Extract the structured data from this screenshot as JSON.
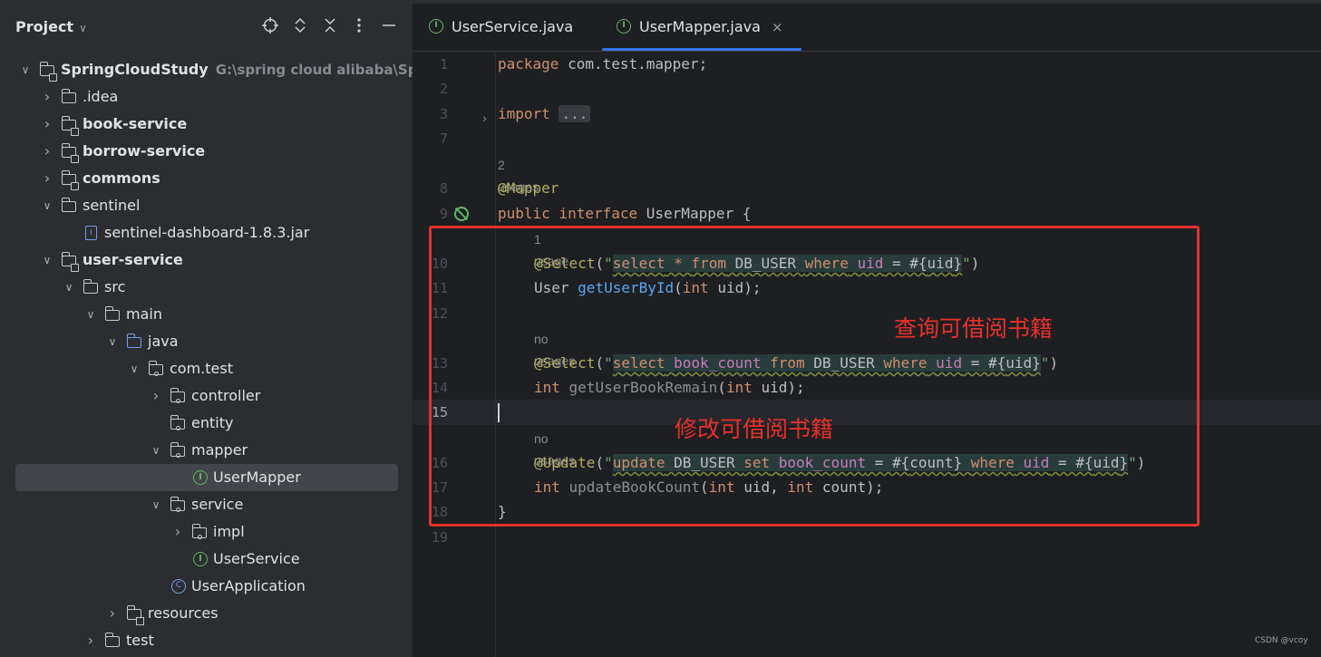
{
  "project_panel": {
    "title": "Project",
    "header_icons": [
      "locate-icon",
      "expand-all-icon",
      "collapse-all-icon",
      "more-icon",
      "minimize-icon"
    ],
    "tree": [
      {
        "label": "SpringCloudStudy",
        "hint": "G:\\spring cloud alibaba\\Sprin",
        "icon": "module-folder-icon",
        "depth": 0,
        "expanded": true,
        "bold": true
      },
      {
        "label": ".idea",
        "icon": "folder-icon",
        "depth": 1,
        "expanded": false,
        "bold": false
      },
      {
        "label": "book-service",
        "icon": "module-folder-icon",
        "depth": 1,
        "expanded": false,
        "bold": true
      },
      {
        "label": "borrow-service",
        "icon": "module-folder-icon",
        "depth": 1,
        "expanded": false,
        "bold": true
      },
      {
        "label": "commons",
        "icon": "module-folder-icon",
        "depth": 1,
        "expanded": false,
        "bold": true
      },
      {
        "label": "sentinel",
        "icon": "folder-icon",
        "depth": 1,
        "expanded": true,
        "bold": false
      },
      {
        "label": "sentinel-dashboard-1.8.3.jar",
        "icon": "jar-icon",
        "depth": 2,
        "expanded": null,
        "bold": false
      },
      {
        "label": "user-service",
        "icon": "module-folder-icon",
        "depth": 1,
        "expanded": true,
        "bold": true
      },
      {
        "label": "src",
        "icon": "folder-icon",
        "depth": 2,
        "expanded": true,
        "bold": false
      },
      {
        "label": "main",
        "icon": "folder-icon",
        "depth": 3,
        "expanded": true,
        "bold": false
      },
      {
        "label": "java",
        "icon": "source-folder-icon",
        "depth": 4,
        "expanded": true,
        "bold": false
      },
      {
        "label": "com.test",
        "icon": "package-icon",
        "depth": 5,
        "expanded": true,
        "bold": false
      },
      {
        "label": "controller",
        "icon": "package-icon",
        "depth": 6,
        "expanded": false,
        "bold": false
      },
      {
        "label": "entity",
        "icon": "package-icon",
        "depth": 6,
        "expanded": null,
        "bold": false
      },
      {
        "label": "mapper",
        "icon": "package-icon",
        "depth": 6,
        "expanded": true,
        "bold": false
      },
      {
        "label": "UserMapper",
        "icon": "interface-icon",
        "depth": 7,
        "expanded": null,
        "bold": false,
        "selected": true
      },
      {
        "label": "service",
        "icon": "package-icon",
        "depth": 6,
        "expanded": true,
        "bold": false
      },
      {
        "label": "impl",
        "icon": "package-icon",
        "depth": 7,
        "expanded": false,
        "bold": false
      },
      {
        "label": "UserService",
        "icon": "interface-icon",
        "depth": 7,
        "expanded": null,
        "bold": false
      },
      {
        "label": "UserApplication",
        "icon": "spring-app-icon",
        "depth": 6,
        "expanded": null,
        "bold": false
      },
      {
        "label": "resources",
        "icon": "resources-folder-icon",
        "depth": 4,
        "expanded": false,
        "bold": false
      },
      {
        "label": "test",
        "icon": "folder-icon",
        "depth": 3,
        "expanded": false,
        "bold": false
      }
    ]
  },
  "editor": {
    "tabs": [
      {
        "label": "UserService.java",
        "active": false
      },
      {
        "label": "UserMapper.java",
        "active": true,
        "close": "×"
      }
    ],
    "line_numbers": {
      "l1": "1",
      "l2": "2",
      "l3": "3",
      "l7": "7",
      "l8": "8",
      "l9": "9",
      "l10": "10",
      "l11": "11",
      "l12": "12",
      "l13": "13",
      "l14": "14",
      "l15": "15",
      "l16": "16",
      "l17": "17",
      "l18": "18",
      "l19": "19"
    },
    "code": {
      "package_kw": "package",
      "package_name": " com.test.mapper;",
      "import_kw": "import",
      "import_fold": "...",
      "usages_interface": "2 usages",
      "mapper_annotation": "@Mapper",
      "public_kw": "public",
      "interface_kw": "interface",
      "interface_name": " UserMapper {",
      "usage_1": "1 usage",
      "select1_annotation": "@Select",
      "select1_sql": {
        "p1": "select",
        "p2": " * ",
        "p3": "from",
        "p4": " DB_USER ",
        "p5": "where",
        "p6": " ",
        "p7": "uid",
        "p8": " = #{",
        "p9": "uid",
        "p10": "}"
      },
      "m1_type": "User ",
      "m1_name": "getUserById",
      "m1_open": "(",
      "m1_int": "int",
      "m1_rest": " uid);",
      "usage_2": "no usages",
      "select2_annotation": "@Select",
      "select2_sql": {
        "p1": "select",
        "p2": " ",
        "p3": "book_count",
        "p4": " ",
        "p5": "from",
        "p6": " DB_USER ",
        "p7": "where",
        "p8": " ",
        "p9": "uid",
        "p10": " = #{",
        "p11": "uid",
        "p12": "}"
      },
      "m2_int": "int",
      "m2_name": " getUserBookRemain",
      "m2_open": "(",
      "m2_int2": "int",
      "m2_rest": " uid);",
      "usage_3": "no usages",
      "update_annotation": "@Update",
      "update_sql": {
        "p1": "update",
        "p2": " DB_USER ",
        "p3": "set",
        "p4": " ",
        "p5": "book_count",
        "p6": " = #{",
        "p7": "count",
        "p8": "} ",
        "p9": "where",
        "p10": " ",
        "p11": "uid",
        "p12": " = #{",
        "p13": "uid",
        "p14": "}"
      },
      "m3_int": "int",
      "m3_name": " updateBookCount",
      "m3_open": "(",
      "m3_int2": "int",
      "m3_mid": " uid, ",
      "m3_int3": "int",
      "m3_rest": " count);",
      "closing_brace": "}"
    },
    "annotations": {
      "note_query": "查询可借阅书籍",
      "note_update": "修改可借阅书籍",
      "highlight_color": "#e8302a"
    }
  },
  "watermark": "CSDN @vcoy"
}
